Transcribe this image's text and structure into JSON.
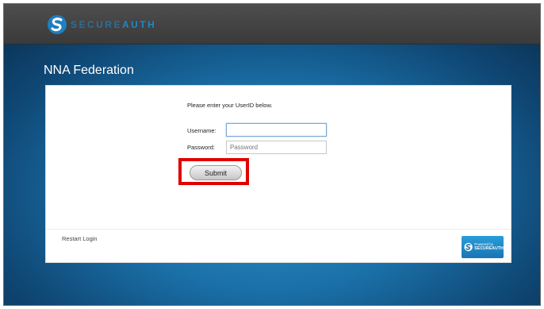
{
  "header": {
    "logo_text_part1": "SECURE",
    "logo_text_part2": "AUTH"
  },
  "page": {
    "title": "NNA Federation"
  },
  "form": {
    "instruction": "Please enter your UserID below.",
    "username_label": "Username:",
    "username_value": "",
    "password_label": "Password:",
    "password_placeholder": "Password",
    "submit_label": "Submit"
  },
  "footer": {
    "restart_label": "Restart Login",
    "badge_line1": "Powered by",
    "badge_line2": "SECUREAUTH"
  },
  "colors": {
    "accent": "#1f88c4",
    "highlight": "#e00000",
    "background_mid": "#1a6fa7",
    "topbar": "#454545"
  }
}
